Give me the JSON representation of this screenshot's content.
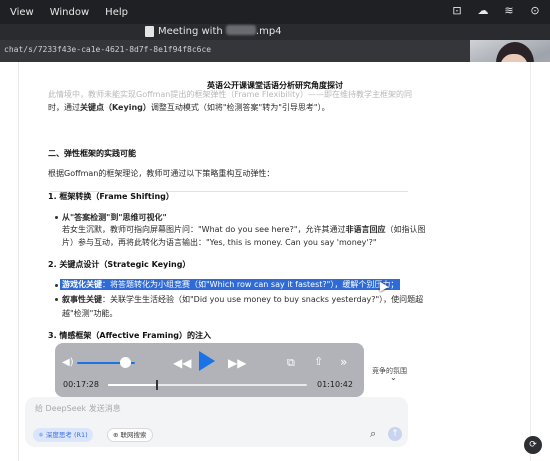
{
  "menu": {
    "items": [
      "View",
      "Window",
      "Help"
    ]
  },
  "system_icons": [
    "screen-record-icon",
    "cloud-icon",
    "wifi-icon",
    "play-circle-icon"
  ],
  "window": {
    "title_prefix": "Meeting with",
    "title_suffix": ".mp4"
  },
  "browser": {
    "url": "chat/s/7233f43e-ca1e-4621-8d7f-8e1f94f8c6ce"
  },
  "document": {
    "title": "英语公开课课堂话语分析研究角度探讨",
    "faded_line": "此情境中，教师未能实现Goffman提出的框架弹性（Frame Flexibility）——即在维持教学主框架的同",
    "intro_line": {
      "prefix": "时，通过",
      "keying": "关键点（Keying）",
      "suffix": "调整互动模式（如将\"检测答案\"转为\"引导思考\"）。"
    },
    "section2_title": "二、弹性框架的实践可能",
    "section2_desc": "根据Goffman的框架理论，教师可通过以下策略重构互动弹性：",
    "sub1_title": "1. 框架转换（Frame Shifting）",
    "bullet1_title": "从\"答案检测\"到\"思维可视化\"",
    "bullet1_line1": {
      "prefix": "若女生沉默，教师可指向屏幕图片问：\"What do you see here?\"，允许其通过",
      "bold": "非语言回应",
      "suffix": "（如指认图"
    },
    "bullet1_line2": "片）参与互动，再将此转化为语言输出：\"Yes, this is money. Can you say 'money'?\"",
    "sub2_title": "2. 关键点设计（Strategic Keying）",
    "bullet2_highlight": {
      "bold": "游戏化关键",
      "text": "：将答题转化为小组竞赛（如\"Which row can say it fastest?\"），缓解个别压力；"
    },
    "bullet3": {
      "bold": "叙事性关键",
      "text": "：关联学生生活经验（如\"Did you use money to buy snacks yesterday?\"），使问题超"
    },
    "bullet3_cont": "越\"检测\"功能。",
    "sub3_title": "3. 情感框架（Affective Framing）的注入",
    "side_fragment": "竞争的氛围"
  },
  "player": {
    "current_time": "00:17:28",
    "total_time": "01:10:42",
    "progress_fraction": 0.247,
    "volume_fraction": 0.82,
    "accent_color": "#1a73e8"
  },
  "chat": {
    "placeholder": "给 DeepSeek 发送消息",
    "deep_think_label": "深度思考 (R1)",
    "web_search_label": "联网搜索"
  }
}
